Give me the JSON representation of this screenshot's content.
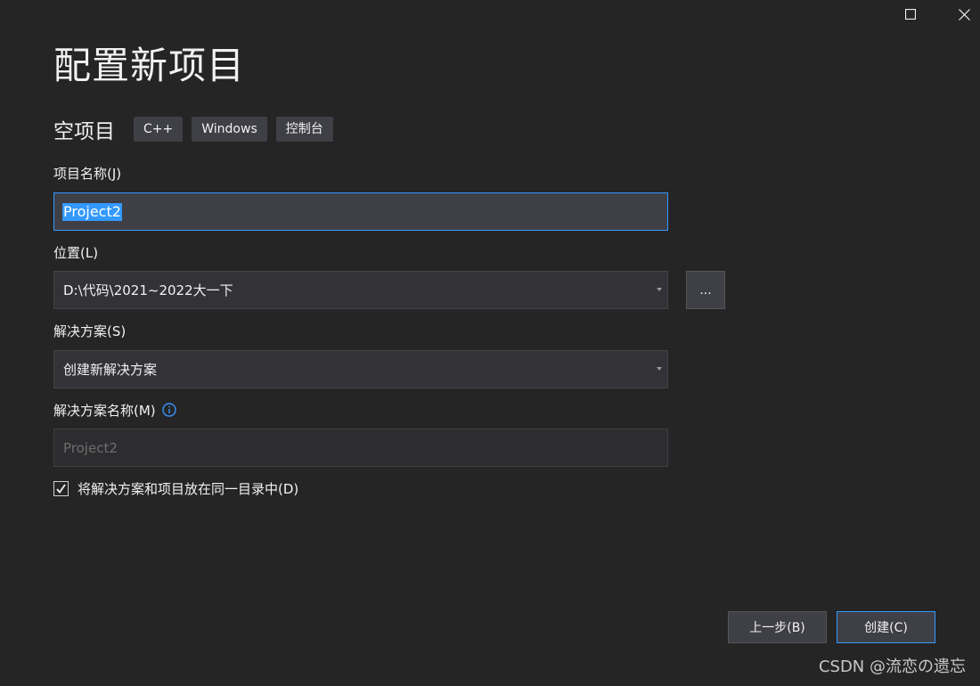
{
  "title": "配置新项目",
  "template": {
    "name": "空项目",
    "tags": [
      "C++",
      "Windows",
      "控制台"
    ]
  },
  "project_name": {
    "label": "项目名称(J)",
    "value": "Project2"
  },
  "location": {
    "label": "位置(L)",
    "value": "D:\\代码\\2021~2022大一下",
    "browse_label": "..."
  },
  "solution": {
    "label": "解决方案(S)",
    "value": "创建新解决方案"
  },
  "solution_name": {
    "label": "解决方案名称(M)",
    "placeholder": "Project2",
    "info_icon": "info-icon"
  },
  "same_directory": {
    "label": "将解决方案和项目放在同一目录中(D)",
    "checked": true
  },
  "buttons": {
    "back": "上一步(B)",
    "create": "创建(C)"
  },
  "watermark": "CSDN @流恋の遗忘",
  "colors": {
    "background": "#252526",
    "accent": "#3399ff",
    "field_bg": "#333337",
    "tag_bg": "#3f3f46"
  }
}
